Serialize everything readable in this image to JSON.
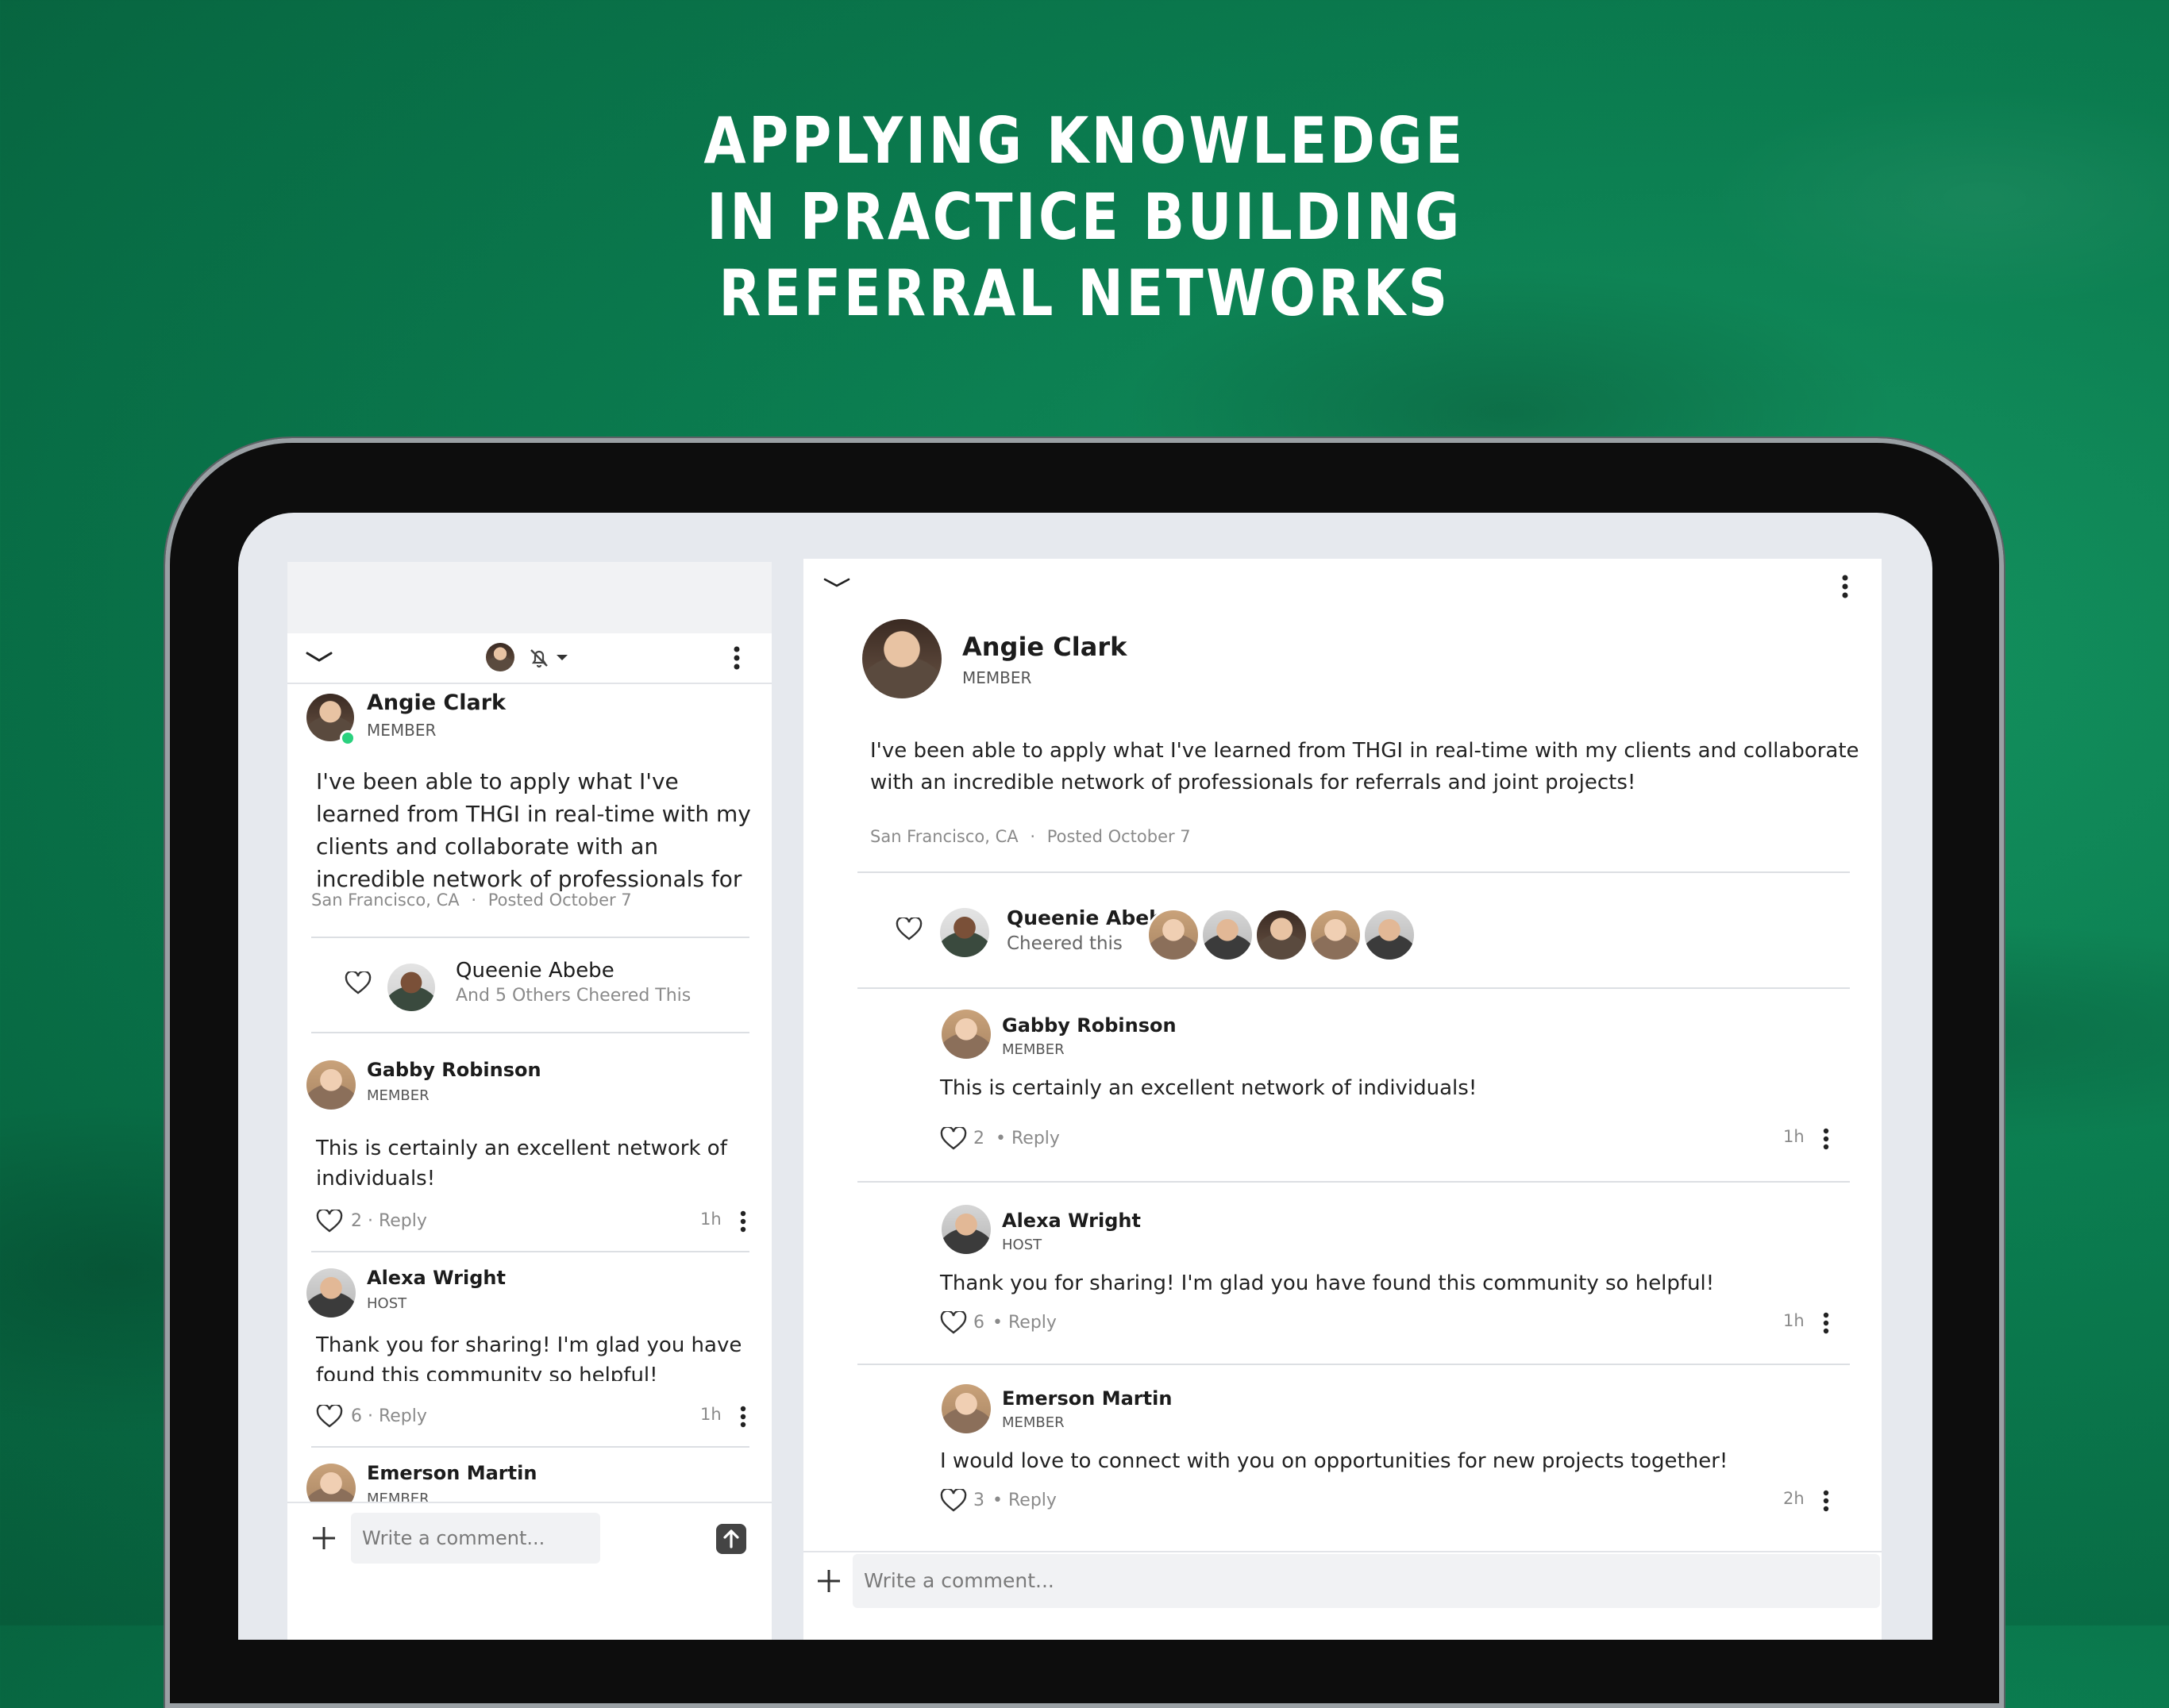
{
  "headline": {
    "line1": "APPLYING KNOWLEDGE",
    "line2": "IN PRACTICE BUILDING",
    "line3": "REFERRAL NETWORKS"
  },
  "post": {
    "author": "Angie Clark",
    "role": "MEMBER",
    "body_full": "I've been able to apply what I've learned from THGI in real-time with my clients and collaborate with an incredible network of professionals for referrals and joint projects!",
    "body_left_line1": "I've been able to apply what I've",
    "body_left_line2": "learned from THGI in real-time with my",
    "body_left_line3": "clients and collaborate with an",
    "body_left_line4": "incredible network of professionals for",
    "location": "San Francisco, CA",
    "separator": "·",
    "posted": "Posted October 7"
  },
  "cheers": {
    "name": "Queenie Abebe",
    "left_sub": "And 5 Others Cheered This",
    "right_sub": "Cheered this"
  },
  "comments": [
    {
      "author": "Gabby Robinson",
      "role": "MEMBER",
      "text": "This is certainly an excellent network of individuals!",
      "text_l1": "This is certainly an excellent network of",
      "text_l2": "individuals!",
      "likes": "2",
      "reply": "Reply",
      "time": "1h",
      "left_meta": "2 · Reply"
    },
    {
      "author": "Alexa Wright",
      "role": "HOST",
      "text": "Thank you for sharing! I'm glad you have found this community so helpful!",
      "text_l1": "Thank you for sharing! I'm glad you have",
      "text_l2": "found this community so helpful!",
      "likes": "6",
      "reply": "Reply",
      "time": "1h",
      "left_meta": "6 · Reply"
    },
    {
      "author": "Emerson Martin",
      "role": "MEMBER",
      "text": "I would love to connect with you on opportunities for new projects together!",
      "likes": "3",
      "reply": "Reply",
      "time": "2h"
    }
  ],
  "composer": {
    "placeholder": "Write a comment...",
    "dot": "•"
  },
  "icons": [
    "chevron-down-icon",
    "more-vertical-icon",
    "bell-off-icon",
    "caret-down-icon",
    "heart-icon",
    "plus-icon",
    "send-arrow-icon"
  ],
  "colors": {
    "background": "#0b7d50",
    "online": "#2ad17e",
    "text": "#1c1c1c"
  }
}
